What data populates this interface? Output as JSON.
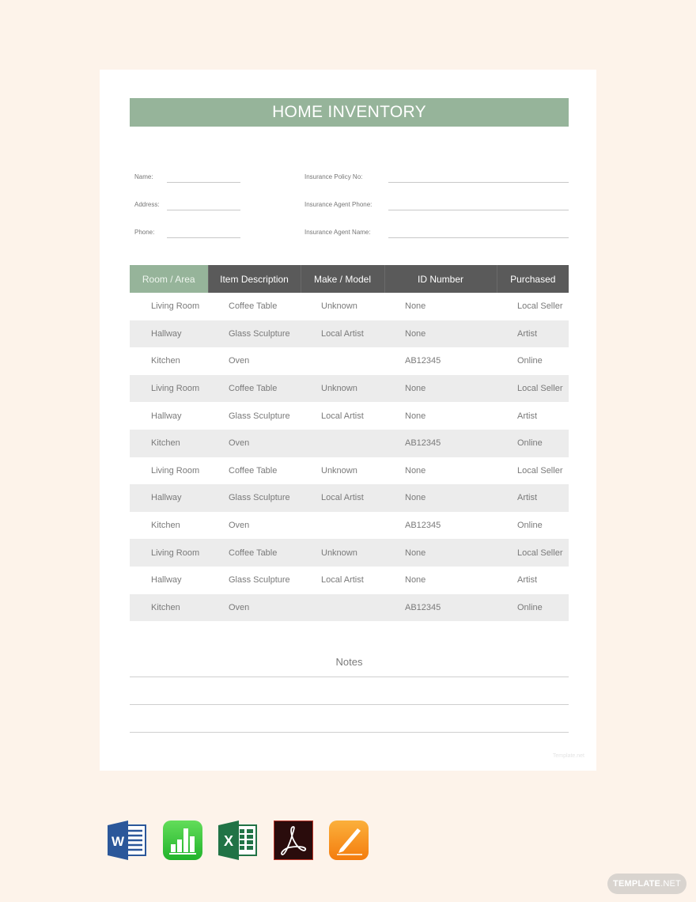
{
  "document": {
    "title": "HOME INVENTORY",
    "watermark": "Template.net"
  },
  "fields": {
    "left": [
      {
        "label": "Name:",
        "value": ""
      },
      {
        "label": "Address:",
        "value": ""
      },
      {
        "label": "Phone:",
        "value": ""
      }
    ],
    "right": [
      {
        "label": "Insurance Policy No:",
        "value": ""
      },
      {
        "label": "Insurance Agent Phone:",
        "value": ""
      },
      {
        "label": "Insurance Agent Name:",
        "value": ""
      }
    ]
  },
  "table": {
    "headers": [
      "Room / Area",
      "Item Description",
      "Make / Model",
      "ID Number",
      "Purchased"
    ],
    "active_header_index": 0,
    "rows": [
      [
        "Living Room",
        "Coffee Table",
        "Unknown",
        "None",
        "Local Seller"
      ],
      [
        "Hallway",
        "Glass Sculpture",
        "Local Artist",
        "None",
        "Artist"
      ],
      [
        "Kitchen",
        "Oven",
        "",
        "AB12345",
        "Online"
      ],
      [
        "Living Room",
        "Coffee Table",
        "Unknown",
        "None",
        "Local Seller"
      ],
      [
        "Hallway",
        "Glass Sculpture",
        "Local Artist",
        "None",
        "Artist"
      ],
      [
        "Kitchen",
        "Oven",
        "",
        "AB12345",
        "Online"
      ],
      [
        "Living Room",
        "Coffee Table",
        "Unknown",
        "None",
        "Local Seller"
      ],
      [
        "Hallway",
        "Glass Sculpture",
        "Local Artist",
        "None",
        "Artist"
      ],
      [
        "Kitchen",
        "Oven",
        "",
        "AB12345",
        "Online"
      ],
      [
        "Living Room",
        "Coffee Table",
        "Unknown",
        "None",
        "Local Seller"
      ],
      [
        "Hallway",
        "Glass Sculpture",
        "Local Artist",
        "None",
        "Artist"
      ],
      [
        "Kitchen",
        "Oven",
        "",
        "AB12345",
        "Online"
      ]
    ]
  },
  "notes": {
    "label": "Notes",
    "lines": [
      "",
      "",
      ""
    ]
  },
  "formats": [
    {
      "name": "Microsoft Word",
      "icon": "word-icon",
      "glyph": "W",
      "color": "#2b579a"
    },
    {
      "name": "Apple Numbers",
      "icon": "numbers-icon",
      "glyph": "",
      "color": "#3cc63c"
    },
    {
      "name": "Microsoft Excel",
      "icon": "excel-icon",
      "glyph": "X",
      "color": "#217346"
    },
    {
      "name": "Adobe PDF",
      "icon": "pdf-icon",
      "glyph": "",
      "color": "#2a0c0c"
    },
    {
      "name": "Apple Pages",
      "icon": "pages-icon",
      "glyph": "",
      "color": "#f7931e"
    }
  ],
  "badge": {
    "bold": "TEMPLATE",
    "thin": ".NET"
  },
  "colors": {
    "accent_green": "#96b49a",
    "header_dark": "#5a5a5a",
    "row_alt": "#ececec",
    "background": "#fdf3ea"
  }
}
